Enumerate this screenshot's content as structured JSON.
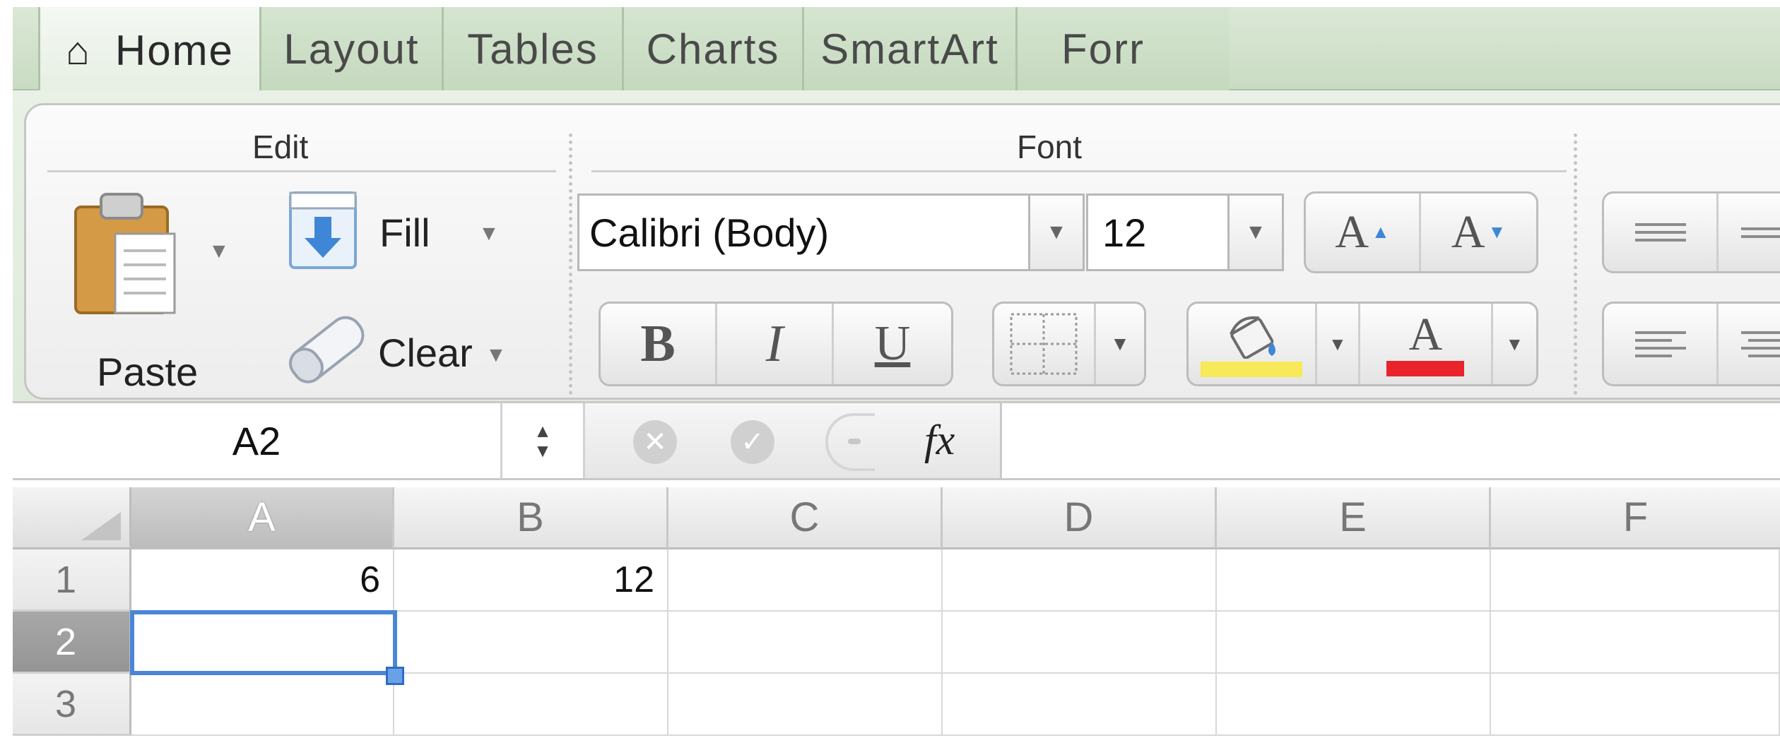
{
  "tabs": [
    {
      "label": "Home",
      "active": true,
      "icon": "home-icon"
    },
    {
      "label": "Layout",
      "active": false
    },
    {
      "label": "Tables",
      "active": false
    },
    {
      "label": "Charts",
      "active": false
    },
    {
      "label": "SmartArt",
      "active": false
    },
    {
      "label": "Forr",
      "active": false
    }
  ],
  "ribbon": {
    "edit": {
      "title": "Edit",
      "paste_label": "Paste",
      "fill_label": "Fill",
      "clear_label": "Clear"
    },
    "font": {
      "title": "Font",
      "font_name": "Calibri (Body)",
      "font_size": "12",
      "grow_label": "A",
      "shrink_label": "A",
      "bold_label": "B",
      "italic_label": "I",
      "underline_label": "U",
      "fill_color_label": "",
      "font_color_label": "A",
      "fill_color": "#f7e95a",
      "font_color": "#e8232c"
    }
  },
  "formula_bar": {
    "name_box": "A2",
    "fx_label": "fx",
    "formula": ""
  },
  "grid": {
    "columns": [
      "A",
      "B",
      "C",
      "D",
      "E",
      "F"
    ],
    "selected_column": "A",
    "rows": [
      {
        "label": "1",
        "cells": [
          "6",
          "12",
          "",
          "",
          "",
          ""
        ]
      },
      {
        "label": "2",
        "cells": [
          "",
          "",
          "",
          "",
          "",
          ""
        ]
      },
      {
        "label": "3",
        "cells": [
          "",
          "",
          "",
          "",
          "",
          ""
        ]
      }
    ],
    "selected_row": "2",
    "selected_cell": "A2"
  },
  "colors": {
    "accent": "#4a86d8",
    "tab_bg": "#c9dcc3"
  }
}
